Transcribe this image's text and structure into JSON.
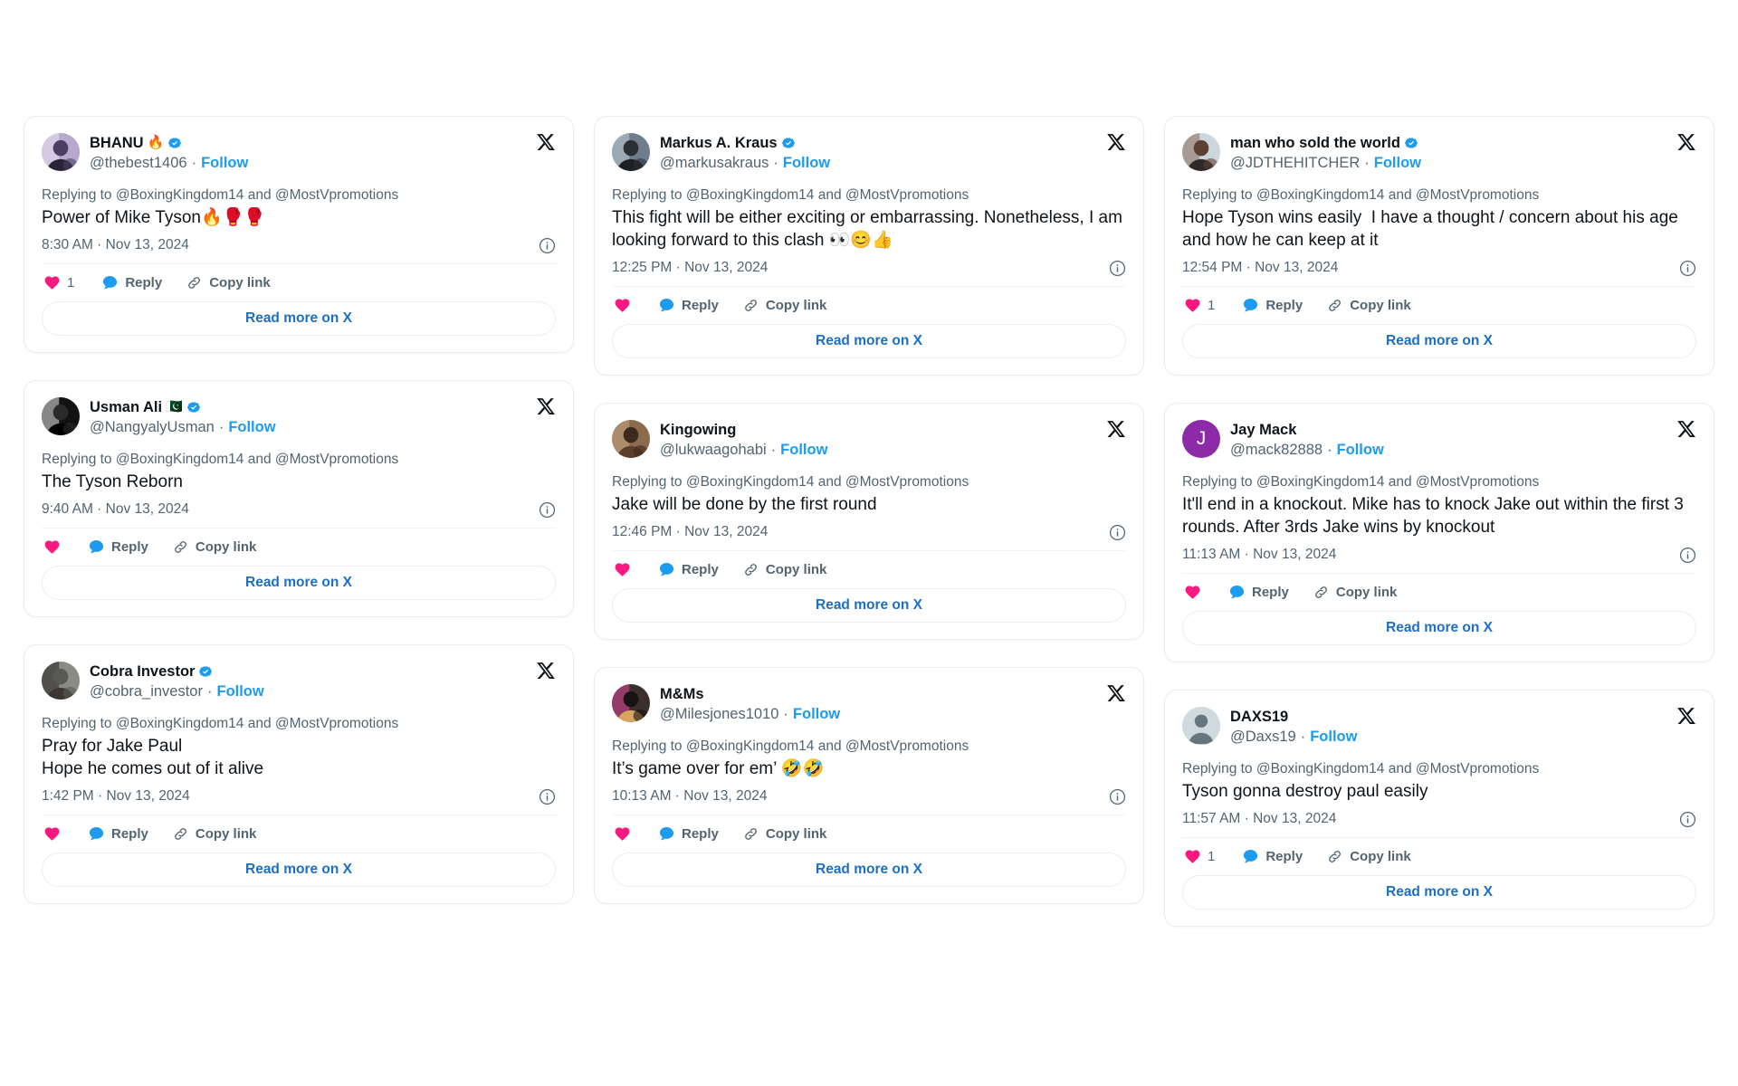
{
  "labels": {
    "reply": "Reply",
    "copy_link": "Copy link",
    "read_more": "Read more on X",
    "follow": "Follow",
    "separator": "·",
    "replying_to": "Replying to @BoxingKingdom14 and @MostVpromotions"
  },
  "colors": {
    "like": "#f91880",
    "reply_icon": "#1d9bf0",
    "link_text": "#1d6fc4",
    "follow_link": "#1d9bf0",
    "verified_badge": "#1d9bf0",
    "muted_text": "#536471",
    "primary_text": "#0f1419",
    "card_border": "#e9ebee",
    "jay_mack_avatar": "#8c2aa8"
  },
  "icons": {
    "x_logo": "x-logo-icon",
    "info": "info-circle-icon",
    "heart": "heart-icon",
    "reply_bubble": "speech-bubble-icon",
    "link": "link-chain-icon",
    "verified": "verified-badge-icon"
  },
  "columns": [
    {
      "cards": [
        {
          "id": "bhanu",
          "display_name": "BHANU",
          "name_emoji": "🔥",
          "handle": "@thebest1406",
          "verified": true,
          "avatar_type": "photo-man-purple-room",
          "replying_to": "Replying to @BoxingKingdom14 and @MostVpromotions",
          "text": "Power of Mike Tyson",
          "text_emoji": "🔥🥊🥊",
          "timestamp": "8:30 AM · Nov 13, 2024",
          "like_count": "1"
        },
        {
          "id": "usman-ali",
          "display_name": "Usman Ali",
          "name_emoji": "🇵🇰",
          "handle": "@NangyalyUsman",
          "verified": true,
          "avatar_type": "photo-black-crescent-moon",
          "replying_to": "Replying to @BoxingKingdom14 and @MostVpromotions",
          "text": "The Tyson Reborn",
          "text_emoji": "",
          "timestamp": "9:40 AM · Nov 13, 2024",
          "like_count": ""
        },
        {
          "id": "cobra-investor",
          "display_name": "Cobra Investor",
          "name_emoji": "",
          "handle": "@cobra_investor",
          "verified": true,
          "avatar_type": "photo-man-side-profile-gray",
          "replying_to": "Replying to @BoxingKingdom14 and @MostVpromotions",
          "text": "Pray for Jake Paul\nHope he comes out of it alive",
          "text_emoji": "",
          "timestamp": "1:42 PM · Nov 13, 2024",
          "like_count": ""
        }
      ]
    },
    {
      "cards": [
        {
          "id": "markus-a-kraus",
          "display_name": "Markus A. Kraus",
          "name_emoji": "",
          "handle": "@markusakraus",
          "verified": true,
          "avatar_type": "photo-man-mountain",
          "replying_to": "Replying to @BoxingKingdom14 and @MostVpromotions",
          "text": "This fight will be either exciting or embarrassing. Nonetheless, I am looking forward to this clash ",
          "text_emoji": "👀😊👍",
          "timestamp": "12:25 PM · Nov 13, 2024",
          "like_count": ""
        },
        {
          "id": "kingowing",
          "display_name": "Kingowing",
          "name_emoji": "",
          "handle": "@lukwaagohabi",
          "verified": false,
          "avatar_type": "photo-man-brown",
          "replying_to": "Replying to @BoxingKingdom14 and @MostVpromotions",
          "text": "Jake will be done by the first round",
          "text_emoji": "",
          "timestamp": "12:46 PM · Nov 13, 2024",
          "like_count": ""
        },
        {
          "id": "m-and-ms",
          "display_name": "M&Ms",
          "name_emoji": "",
          "handle": "@Milesjones1010",
          "verified": false,
          "avatar_type": "photo-person-dark-pink",
          "replying_to": "Replying to @BoxingKingdom14 and @MostVpromotions",
          "text": "It’s game over for em’ ",
          "text_emoji": "🤣🤣",
          "timestamp": "10:13 AM · Nov 13, 2024",
          "like_count": ""
        }
      ]
    },
    {
      "cards": [
        {
          "id": "man-who-sold-the-world",
          "display_name": "man who sold the world",
          "name_emoji": "",
          "handle": "@JDTHEHITCHER",
          "verified": true,
          "avatar_type": "photo-smiling-man",
          "replying_to": "Replying to @BoxingKingdom14 and @MostVpromotions",
          "text": "Hope Tyson wins easily  I have a thought / concern about his age and how he can keep at it",
          "text_emoji": "",
          "timestamp": "12:54 PM · Nov 13, 2024",
          "like_count": "1"
        },
        {
          "id": "jay-mack",
          "display_name": "Jay Mack",
          "name_emoji": "",
          "handle": "@mack82888",
          "verified": false,
          "avatar_type": "initial-purple-J",
          "avatar_initial": "J",
          "replying_to": "Replying to @BoxingKingdom14 and @MostVpromotions",
          "text": "It'll end in a knockout. Mike has to knock Jake out within the first 3 rounds. After 3rds Jake wins by knockout",
          "text_emoji": "",
          "timestamp": "11:13 AM · Nov 13, 2024",
          "like_count": ""
        },
        {
          "id": "daxs19",
          "display_name": "DAXS19",
          "name_emoji": "",
          "handle": "@Daxs19",
          "verified": false,
          "avatar_type": "default-gray-person",
          "replying_to": "Replying to @BoxingKingdom14 and @MostVpromotions",
          "text": "Tyson gonna destroy paul easily",
          "text_emoji": "",
          "timestamp": "11:57 AM · Nov 13, 2024",
          "like_count": "1"
        }
      ]
    }
  ]
}
